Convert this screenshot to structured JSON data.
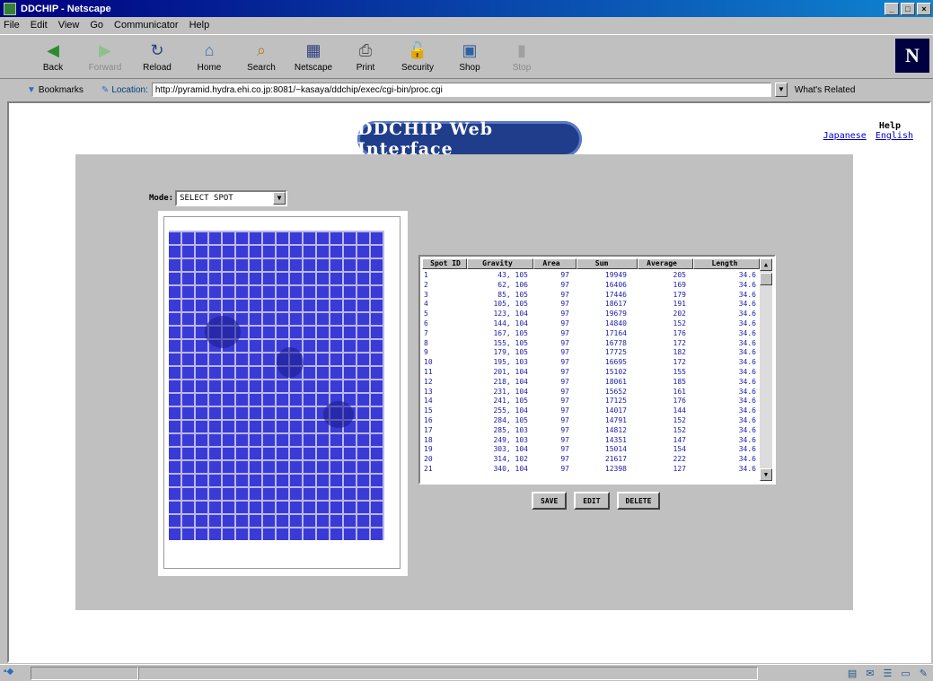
{
  "window": {
    "title": "DDCHIP - Netscape",
    "controls": [
      "_",
      "□",
      "×"
    ]
  },
  "menu": [
    "File",
    "Edit",
    "View",
    "Go",
    "Communicator",
    "Help"
  ],
  "toolbar": [
    {
      "label": "Back",
      "icon": "back-arrow-icon",
      "glyph": "◀",
      "enabled": true
    },
    {
      "label": "Forward",
      "icon": "forward-arrow-icon",
      "glyph": "▶",
      "enabled": false
    },
    {
      "label": "Reload",
      "icon": "reload-icon",
      "glyph": "↻",
      "enabled": true
    },
    {
      "label": "Home",
      "icon": "home-icon",
      "glyph": "⌂",
      "enabled": true
    },
    {
      "label": "Search",
      "icon": "search-icon",
      "glyph": "⌕",
      "enabled": true
    },
    {
      "label": "Netscape",
      "icon": "netscape-icon",
      "glyph": "▦",
      "enabled": true
    },
    {
      "label": "Print",
      "icon": "print-icon",
      "glyph": "⎙",
      "enabled": true
    },
    {
      "label": "Security",
      "icon": "lock-icon",
      "glyph": "🔓",
      "enabled": true
    },
    {
      "label": "Shop",
      "icon": "shop-icon",
      "glyph": "▣",
      "enabled": true
    },
    {
      "label": "Stop",
      "icon": "stop-icon",
      "glyph": "▮",
      "enabled": false
    }
  ],
  "brand_logo": "N",
  "location": {
    "bookmarks_label": "Bookmarks",
    "location_label": "Location:",
    "url": "http://pyramid.hydra.ehi.co.jp:8081/~kasaya/ddchip/exec/cgi-bin/proc.cgi",
    "related_label": "What's Related"
  },
  "page": {
    "logo_text": "DDCHIP Web Interface",
    "help": {
      "title": "Help",
      "japanese": "Japanese",
      "english": "English"
    },
    "mode": {
      "label": "Mode:",
      "value": "SELECT SPOT"
    },
    "table": {
      "headers": [
        "Spot ID",
        "Gravity",
        "Area",
        "Sum",
        "Average",
        "Length"
      ],
      "rows": [
        [
          "1",
          "43, 105",
          "97",
          "19949",
          "205",
          "34.6"
        ],
        [
          "2",
          "62, 106",
          "97",
          "16406",
          "169",
          "34.6"
        ],
        [
          "3",
          "85, 105",
          "97",
          "17446",
          "179",
          "34.6"
        ],
        [
          "4",
          "105, 105",
          "97",
          "18617",
          "191",
          "34.6"
        ],
        [
          "5",
          "123, 104",
          "97",
          "19679",
          "202",
          "34.6"
        ],
        [
          "6",
          "144, 104",
          "97",
          "14840",
          "152",
          "34.6"
        ],
        [
          "7",
          "167, 105",
          "97",
          "17164",
          "176",
          "34.6"
        ],
        [
          "8",
          "155, 105",
          "97",
          "16778",
          "172",
          "34.6"
        ],
        [
          "9",
          "179, 105",
          "97",
          "17725",
          "182",
          "34.6"
        ],
        [
          "10",
          "195, 103",
          "97",
          "16695",
          "172",
          "34.6"
        ],
        [
          "11",
          "201, 104",
          "97",
          "15102",
          "155",
          "34.6"
        ],
        [
          "12",
          "218, 104",
          "97",
          "18061",
          "185",
          "34.6"
        ],
        [
          "13",
          "231, 104",
          "97",
          "15652",
          "161",
          "34.6"
        ],
        [
          "14",
          "241, 105",
          "97",
          "17125",
          "176",
          "34.6"
        ],
        [
          "15",
          "255, 104",
          "97",
          "14017",
          "144",
          "34.6"
        ],
        [
          "16",
          "284, 105",
          "97",
          "14791",
          "152",
          "34.6"
        ],
        [
          "17",
          "285, 103",
          "97",
          "14812",
          "152",
          "34.6"
        ],
        [
          "18",
          "249, 103",
          "97",
          "14351",
          "147",
          "34.6"
        ],
        [
          "19",
          "303, 104",
          "97",
          "15014",
          "154",
          "34.6"
        ],
        [
          "20",
          "314, 102",
          "97",
          "21617",
          "222",
          "34.6"
        ],
        [
          "21",
          "340, 104",
          "97",
          "12398",
          "127",
          "34.6"
        ]
      ]
    },
    "buttons": {
      "save": "SAVE",
      "edit": "EDIT",
      "delete": "DELETE"
    }
  },
  "colors": {
    "titlebar": "#000080",
    "spot_blue": "#3a3ad6",
    "link": "#0000cc",
    "logo": "#1f3d8a"
  }
}
